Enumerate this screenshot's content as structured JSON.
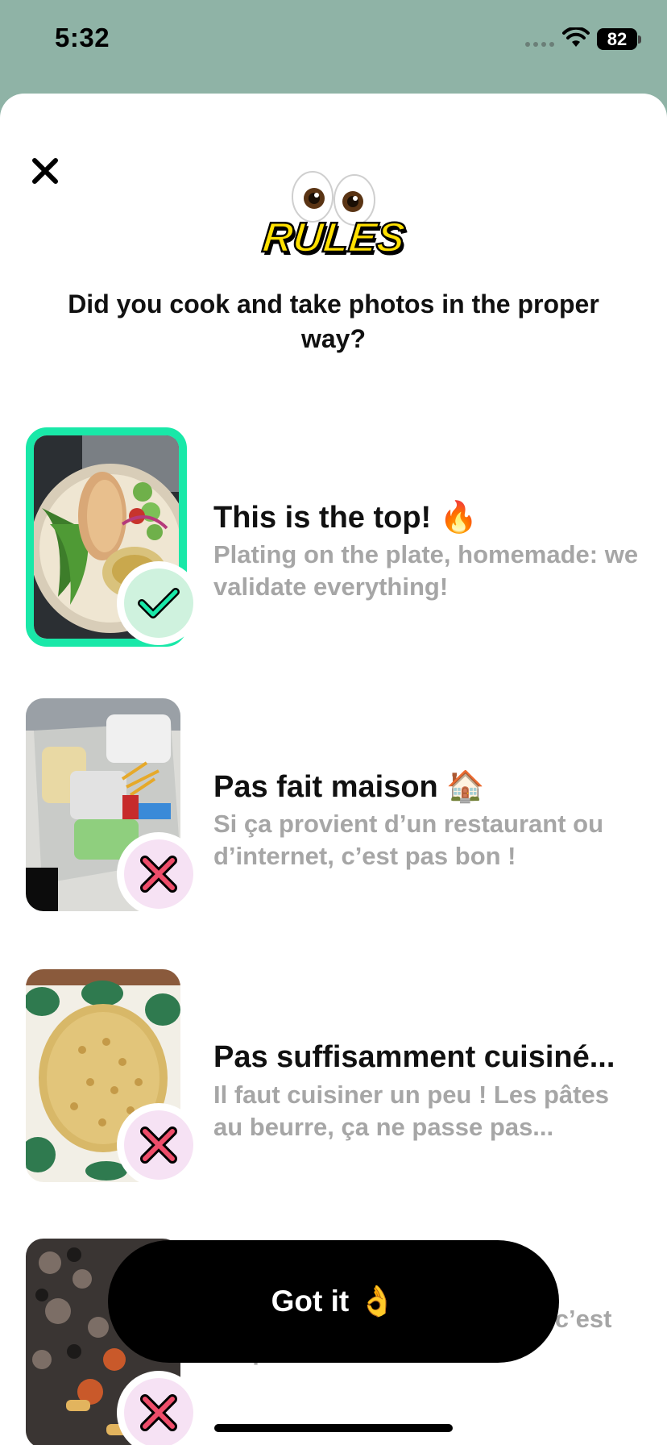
{
  "status_bar": {
    "time": "5:32",
    "battery": "82"
  },
  "header": {
    "logo_text": "RULES",
    "headline": "Did you cook and take photos in the proper way?"
  },
  "rules": [
    {
      "title": "This is the top! 🔥",
      "description": "Plating on the plate, homemade: we validate everything!",
      "status": "valid"
    },
    {
      "title": "Pas fait maison 🏠",
      "description": "Si ça provient d’un restaurant ou d’internet, c’est pas bon !",
      "status": "invalid"
    },
    {
      "title": "Pas suffisamment cuisiné...",
      "description": "Il faut cuisiner un peu ! Les pâtes au beurre, ça ne passe pas...",
      "status": "invalid"
    },
    {
      "description": "ou si ça manque de lumière, c’est risqué !",
      "status": "invalid"
    }
  ],
  "button": {
    "label": "Got it",
    "emoji": "👌"
  },
  "colors": {
    "accent_green": "#19e8a8",
    "background_sage": "#8fb3a6",
    "muted_text": "#a6a6a6"
  },
  "icons": {
    "close": "close-icon",
    "valid": "check-icon",
    "invalid": "cross-icon"
  }
}
